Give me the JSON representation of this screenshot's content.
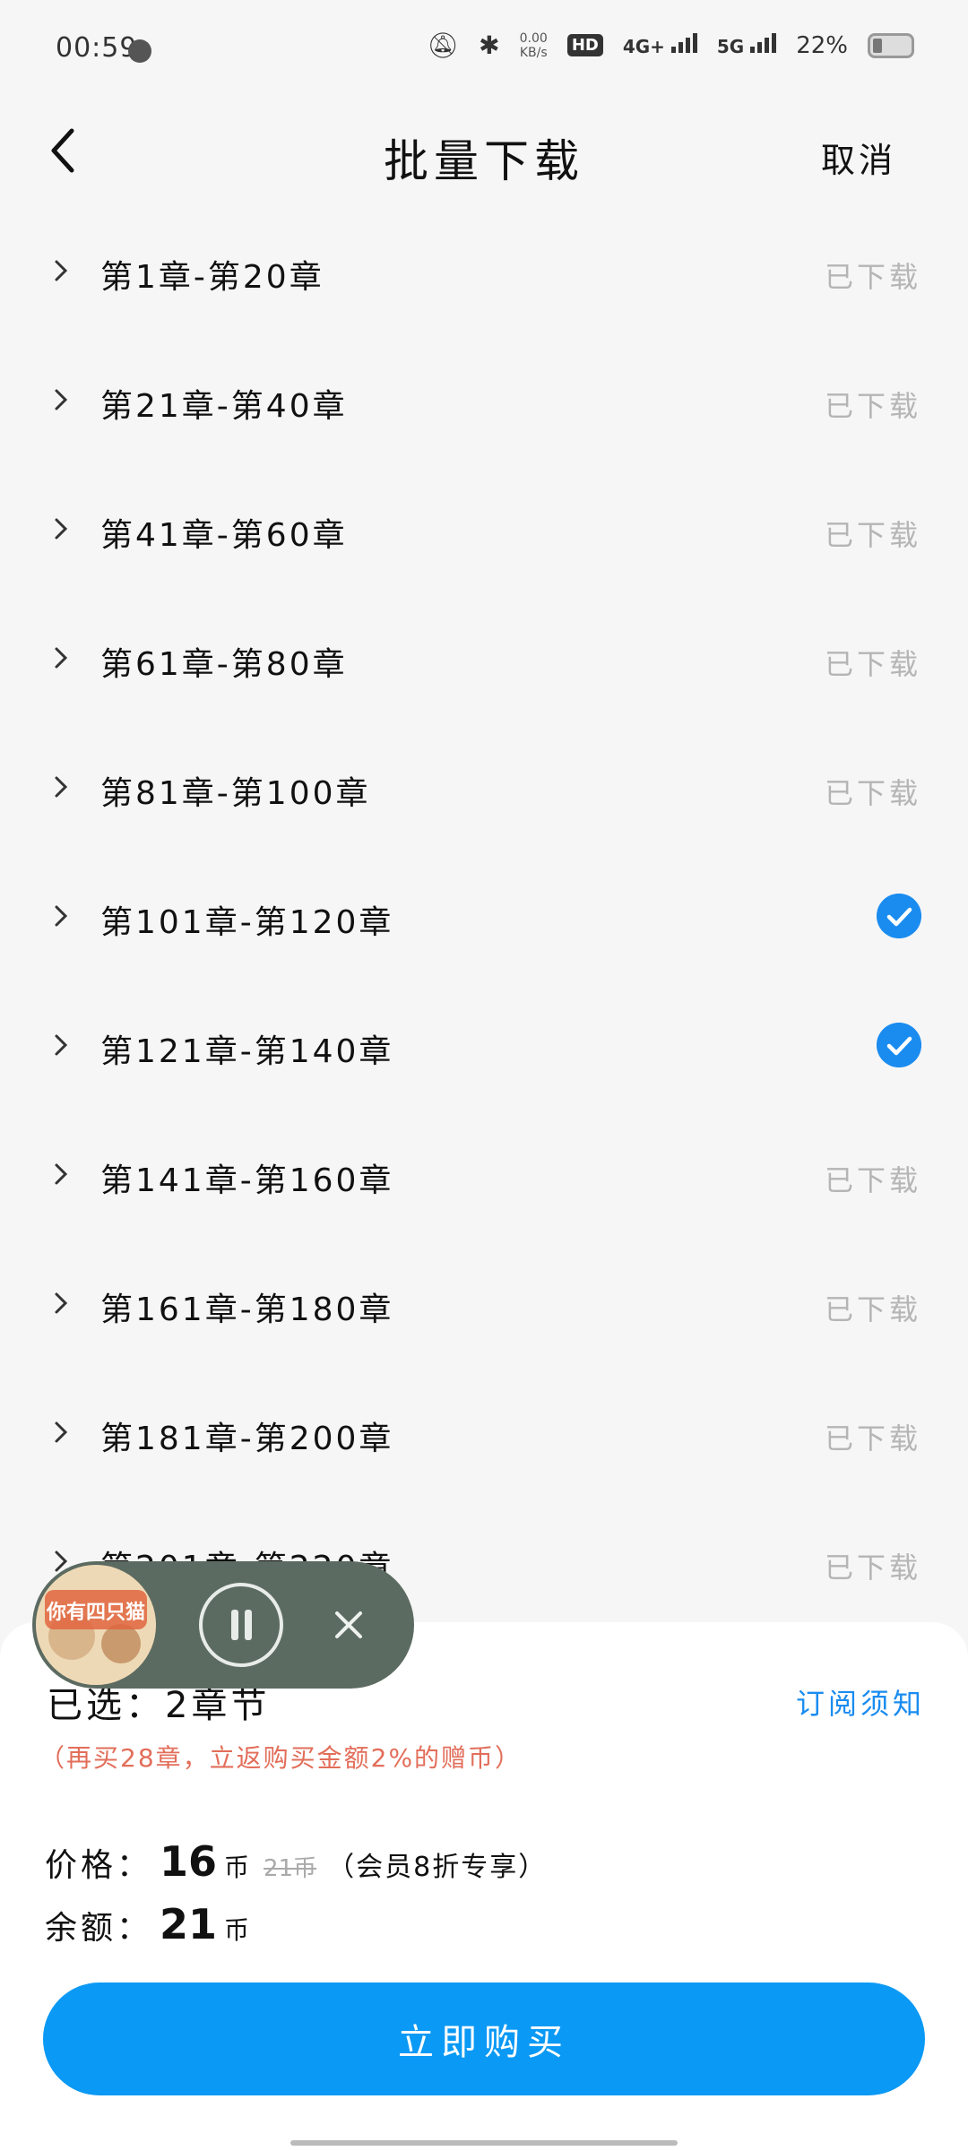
{
  "status_bar": {
    "time": "00:59",
    "net_speed_value": "0.00",
    "net_speed_unit": "KB/s",
    "hd_label": "HD",
    "net_4g": "4G+",
    "net_5g": "5G",
    "battery_text": "22%"
  },
  "header": {
    "title": "批量下载",
    "cancel_label": "取消"
  },
  "chapters": [
    {
      "label": "第1章-第20章",
      "status": "已下载",
      "selected": false
    },
    {
      "label": "第21章-第40章",
      "status": "已下载",
      "selected": false
    },
    {
      "label": "第41章-第60章",
      "status": "已下载",
      "selected": false
    },
    {
      "label": "第61章-第80章",
      "status": "已下载",
      "selected": false
    },
    {
      "label": "第81章-第100章",
      "status": "已下载",
      "selected": false
    },
    {
      "label": "第101章-第120章",
      "status": "",
      "selected": true
    },
    {
      "label": "第121章-第140章",
      "status": "",
      "selected": true
    },
    {
      "label": "第141章-第160章",
      "status": "已下载",
      "selected": false
    },
    {
      "label": "第161章-第180章",
      "status": "已下载",
      "selected": false
    },
    {
      "label": "第181章-第200章",
      "status": "已下载",
      "selected": false
    },
    {
      "label": "第201章-第220章",
      "status": "已下载",
      "selected": false
    }
  ],
  "sheet": {
    "selected_text": "已选：2章节",
    "notice_link": "订阅须知",
    "promo": "（再买28章，立返购买金额2%的赠币）",
    "price_label": "价格：",
    "price_value": "16",
    "coin_unit": "币",
    "original_price": "21币",
    "vip_note": "（会员8折专享）",
    "balance_label": "余额：",
    "balance_value": "21",
    "buy_button": "立即购买"
  },
  "player": {
    "cover_text": "你有四只猫"
  },
  "colors": {
    "accent": "#0a99f5",
    "check": "#1a8cf0",
    "promo": "#e26e5a",
    "player_bg": "#5c6b61"
  }
}
